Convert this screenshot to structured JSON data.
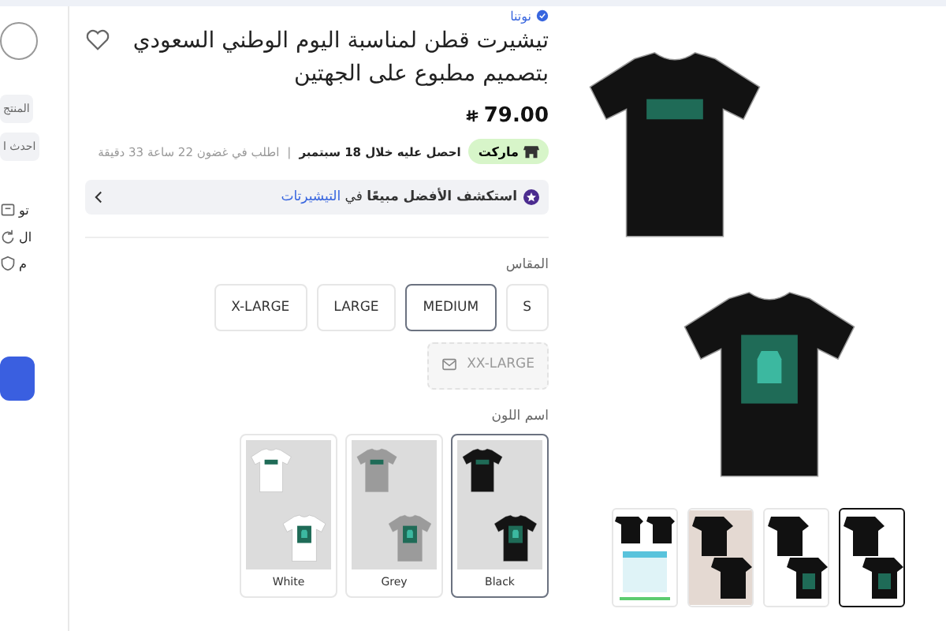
{
  "sidebar": {
    "chips": [
      "المنتج",
      "احدث ا"
    ],
    "features": [
      {
        "kind": "box",
        "label": "تو"
      },
      {
        "kind": "return",
        "label": "ال"
      },
      {
        "kind": "shield",
        "label": "م"
      }
    ]
  },
  "breadcrumb": "نوتنا",
  "product": {
    "title": "تيشيرت قطن لمناسبة اليوم الوطني السعودي بتصميم مطبوع على الجهتين",
    "favorite": false,
    "price": "79.00"
  },
  "delivery": {
    "badge": "ماركت",
    "lead": "احصل عليه خلال 18 سبتمبر",
    "separator": "|",
    "note": "اطلب في غضون 22 ساعة 33 دقيقة"
  },
  "bestseller": {
    "text": "**استكشف الأفضل مبيعًا** في",
    "link": "التيشيرتات"
  },
  "size": {
    "label": "المقاس",
    "options": [
      {
        "label": "S",
        "selected": false,
        "available": true
      },
      {
        "label": "MEDIUM",
        "selected": true,
        "available": true
      },
      {
        "label": "LARGE",
        "selected": false,
        "available": true
      },
      {
        "label": "X-LARGE",
        "selected": false,
        "available": true
      },
      {
        "label": "XX-LARGE",
        "selected": false,
        "available": false
      }
    ]
  },
  "colour": {
    "label": "اسم اللون",
    "options": [
      {
        "label": "Black",
        "selected": true,
        "color": "#141414"
      },
      {
        "label": "Grey",
        "selected": false,
        "color": "#9b9b9b"
      },
      {
        "label": "White",
        "selected": false,
        "color": "#ffffff"
      }
    ]
  },
  "gallery": {
    "thumbnails": [
      {
        "kind": "pair",
        "selected": true
      },
      {
        "kind": "pair",
        "selected": false
      },
      {
        "kind": "model",
        "selected": false
      },
      {
        "kind": "chart",
        "selected": false
      }
    ]
  }
}
